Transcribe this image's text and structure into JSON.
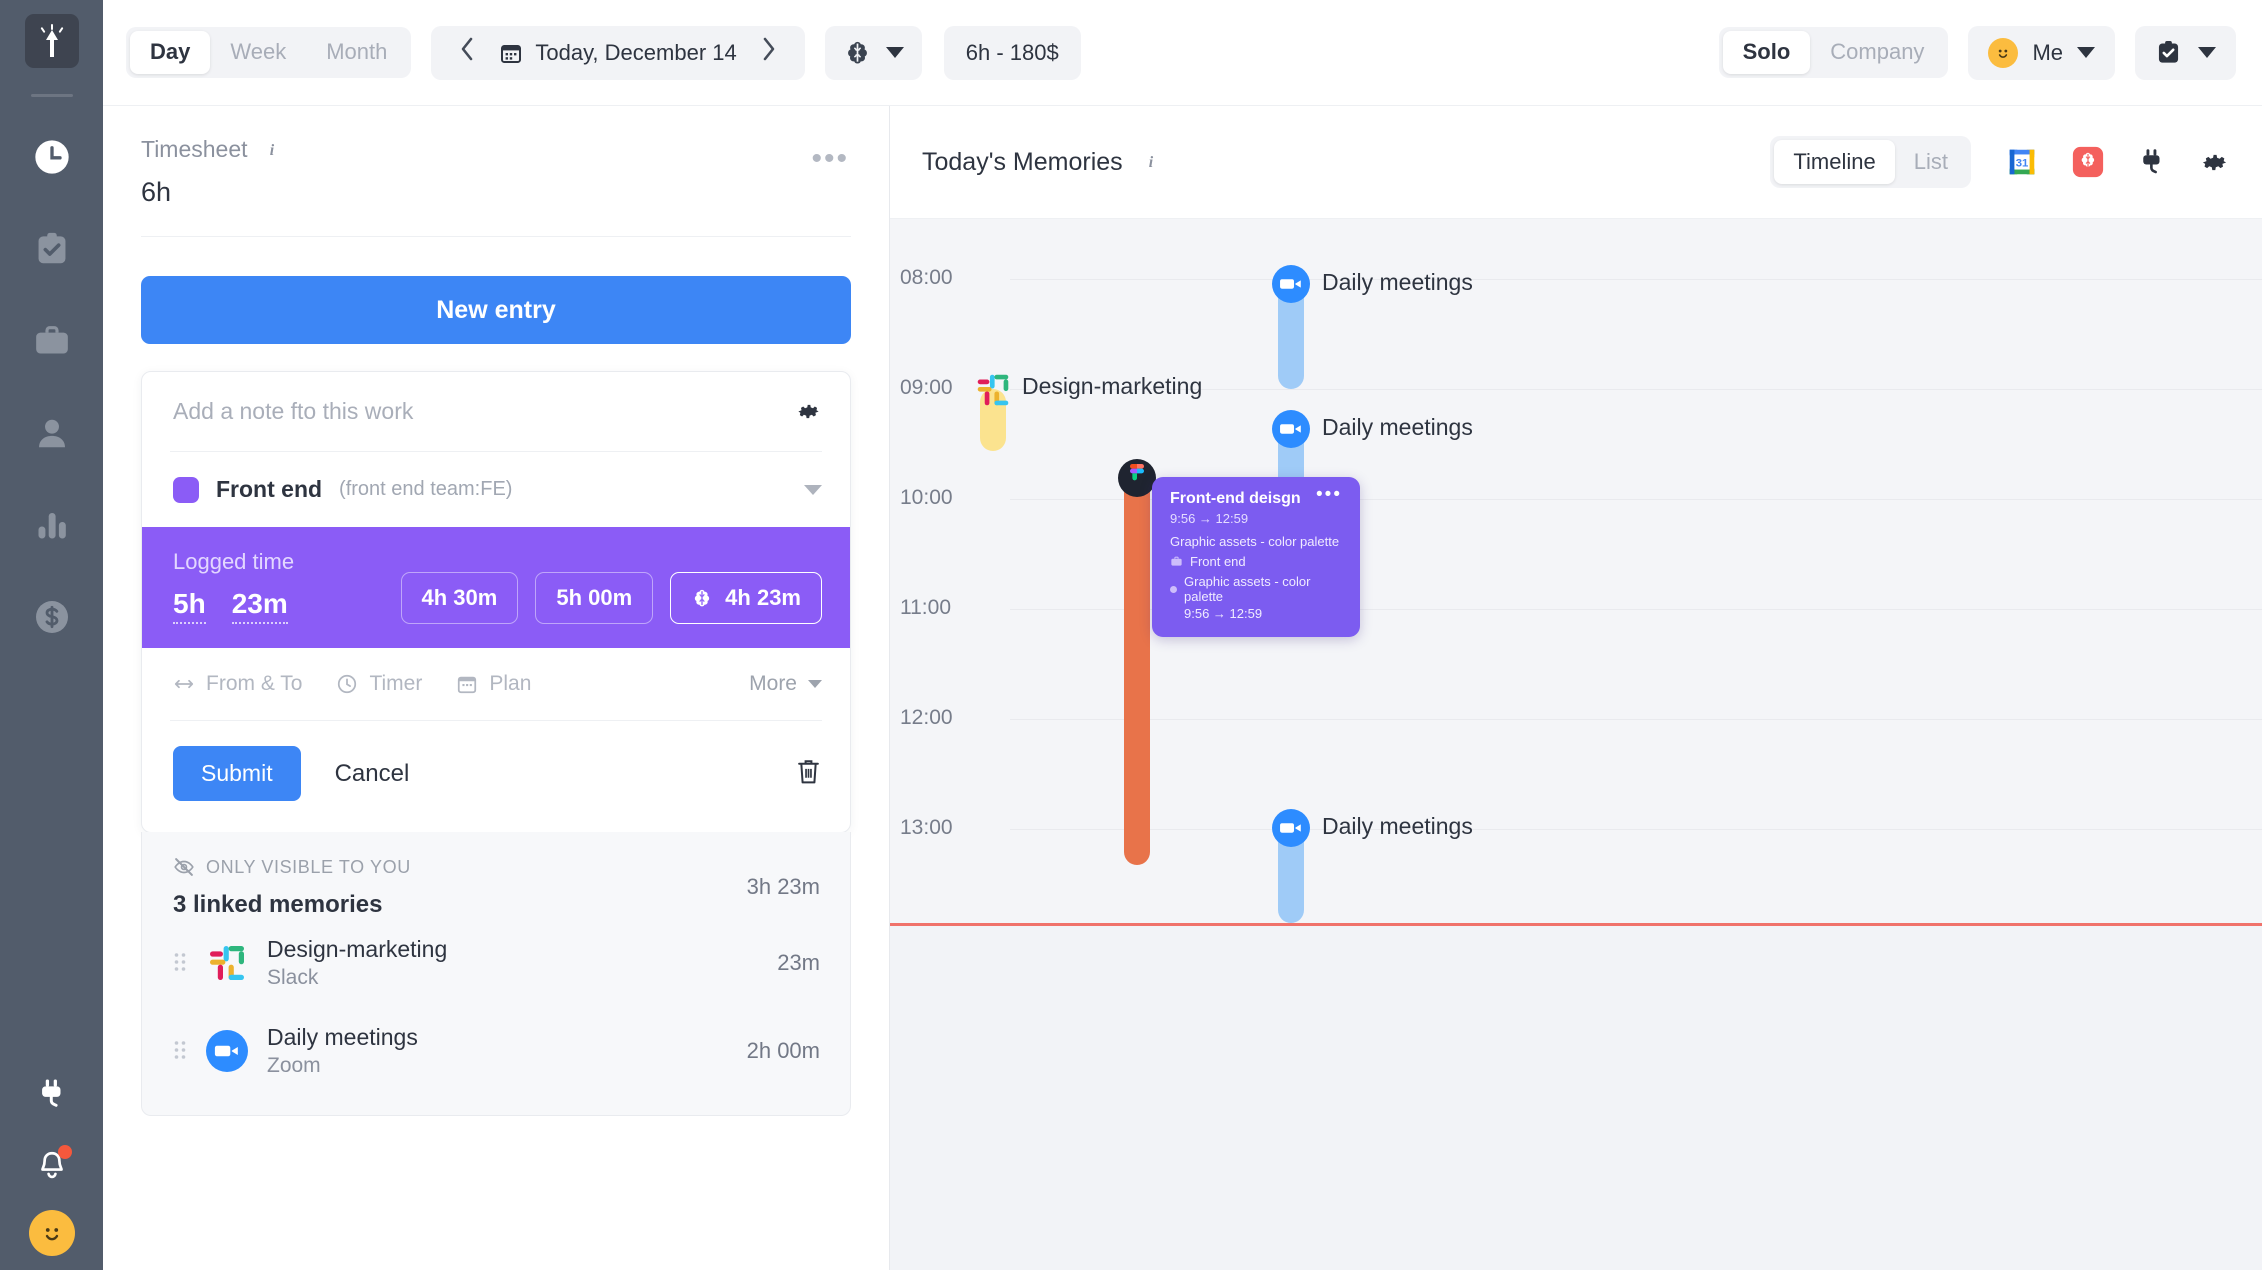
{
  "accent": {
    "blue": "#3d86f5",
    "purple": "#8b5cf6",
    "card_purple": "#7c5cf0",
    "orange": "#e8734a",
    "zoom_blue": "#9fcbf7",
    "slack_yellow": "#fbe38f",
    "rail": "#525c6b",
    "now_red": "#f0726b"
  },
  "rail": {
    "logo_icon": "rocket-logo-icon",
    "items": [
      {
        "name": "sidebar-item-time",
        "icon": "clock-icon",
        "active": true
      },
      {
        "name": "sidebar-item-approvals",
        "icon": "clipboard-check-icon",
        "active": false
      },
      {
        "name": "sidebar-item-projects",
        "icon": "briefcase-icon",
        "active": false
      },
      {
        "name": "sidebar-item-people",
        "icon": "person-icon",
        "active": false
      },
      {
        "name": "sidebar-item-reports",
        "icon": "bar-chart-icon",
        "active": false
      },
      {
        "name": "sidebar-item-billing",
        "icon": "dollar-coin-icon",
        "active": false
      }
    ],
    "bottom": [
      {
        "name": "sidebar-item-integrations",
        "icon": "plug-icon",
        "badge": false
      },
      {
        "name": "sidebar-item-notifications",
        "icon": "bell-icon",
        "badge": true
      }
    ],
    "avatar_icon": "smiley-avatar-icon"
  },
  "topbar": {
    "range_tabs": [
      {
        "label": "Day",
        "active": true
      },
      {
        "label": "Week",
        "active": false
      },
      {
        "label": "Month",
        "active": false
      }
    ],
    "prev_icon": "chevron-left-icon",
    "next_icon": "chevron-right-icon",
    "calendar_icon": "calendar-icon",
    "date_label": "Today, December 14",
    "brain_icon": "brain-icon",
    "brain_caret_icon": "chevron-down-icon",
    "money_badge": "6h - 180$",
    "scope_tabs": [
      {
        "label": "Solo",
        "active": true
      },
      {
        "label": "Company",
        "active": false
      }
    ],
    "user_label": "Me",
    "user_avatar_icon": "smiley-avatar-icon",
    "user_caret_icon": "chevron-down-icon",
    "clipboard_icon": "clipboard-check-icon",
    "clipboard_caret_icon": "chevron-down-icon"
  },
  "timesheet": {
    "title": "Timesheet",
    "info_icon": "info-icon",
    "total": "6h",
    "more_icon": "ellipsis-icon",
    "new_entry_label": "New entry"
  },
  "entry": {
    "note_value": "",
    "note_placeholder": "Add a note fto this work",
    "settings_icon": "gear-icon",
    "project_color": "#8b5cf6",
    "project_name": "Front end",
    "project_meta": "(front end team:FE)",
    "project_caret_icon": "chevron-down-icon",
    "logged": {
      "label": "Logged time",
      "hours": "5h",
      "minutes": "23m",
      "suggestions": [
        {
          "label": "4h 30m",
          "icon": null,
          "strong": false
        },
        {
          "label": "5h 00m",
          "icon": null,
          "strong": false
        },
        {
          "label": "4h 23m",
          "icon": "brain-icon",
          "strong": true
        }
      ]
    },
    "tools": [
      {
        "label": "From & To",
        "icon": "arrows-horizontal-icon"
      },
      {
        "label": "Timer",
        "icon": "clock-icon"
      },
      {
        "label": "Plan",
        "icon": "calendar-icon"
      }
    ],
    "more_label": "More",
    "more_caret_icon": "chevron-down-icon",
    "submit_label": "Submit",
    "cancel_label": "Cancel",
    "delete_icon": "trash-icon"
  },
  "linked": {
    "visibility_icon": "eye-off-icon",
    "visibility_label": "ONLY VISIBLE TO YOU",
    "count_label": "3 linked memories",
    "total": "3h 23m",
    "items": [
      {
        "grip_icon": "drag-grip-icon",
        "app_icon": "slack-icon",
        "title": "Design-marketing",
        "source": "Slack",
        "duration": "23m"
      },
      {
        "grip_icon": "drag-grip-icon",
        "app_icon": "zoom-icon",
        "title": "Daily meetings",
        "source": "Zoom",
        "duration": "2h 00m"
      }
    ]
  },
  "memories": {
    "title": "Today's Memories",
    "info_icon": "info-icon",
    "view_tabs": [
      {
        "label": "Timeline",
        "active": true
      },
      {
        "label": "List",
        "active": false
      }
    ],
    "head_icons": [
      {
        "name": "google-calendar-icon"
      },
      {
        "name": "brain-icon"
      },
      {
        "name": "plug-icon"
      },
      {
        "name": "gear-icon"
      }
    ],
    "hours": [
      "08:00",
      "09:00",
      "10:00",
      "11:00",
      "12:00",
      "13:00"
    ],
    "events": [
      {
        "name": "event-daily-meetings-0800",
        "label": "Daily meetings",
        "icon": "zoom-icon",
        "color": "#9fcbf7",
        "start_hour": 8.0,
        "end_hour": 8.83,
        "lane": 540
      },
      {
        "name": "event-design-marketing",
        "label": "Design-marketing",
        "icon": "slack-icon",
        "color": "#fbe38f",
        "start_hour": 9.0,
        "end_hour": 9.38,
        "lane": 90
      },
      {
        "name": "event-daily-meetings-1000",
        "label": "Daily meetings",
        "icon": "zoom-icon",
        "color": "#9fcbf7",
        "start_hour": 9.95,
        "end_hour": 10.6,
        "lane": 540
      },
      {
        "name": "event-front-end-design",
        "label": "Front-end deisgn",
        "icon": "figma-icon",
        "color": "#e8734a",
        "start_hour": 9.93,
        "end_hour": 13.0,
        "lane": 380
      },
      {
        "name": "event-daily-meetings-1300",
        "label": "Daily meetings",
        "icon": "zoom-icon",
        "color": "#9fcbf7",
        "start_hour": 13.0,
        "end_hour": 13.6,
        "lane": 540
      }
    ],
    "detail_card": {
      "title": "Front-end deisgn",
      "time": "9:56 → 12:59",
      "description": "Graphic assets - color palette",
      "project_icon": "briefcase-icon",
      "project": "Front end",
      "task_bullet_icon": "dot-icon",
      "task": "Graphic assets - color palette",
      "task_time": "9:56 → 12:59",
      "menu_icon": "ellipsis-icon"
    }
  }
}
